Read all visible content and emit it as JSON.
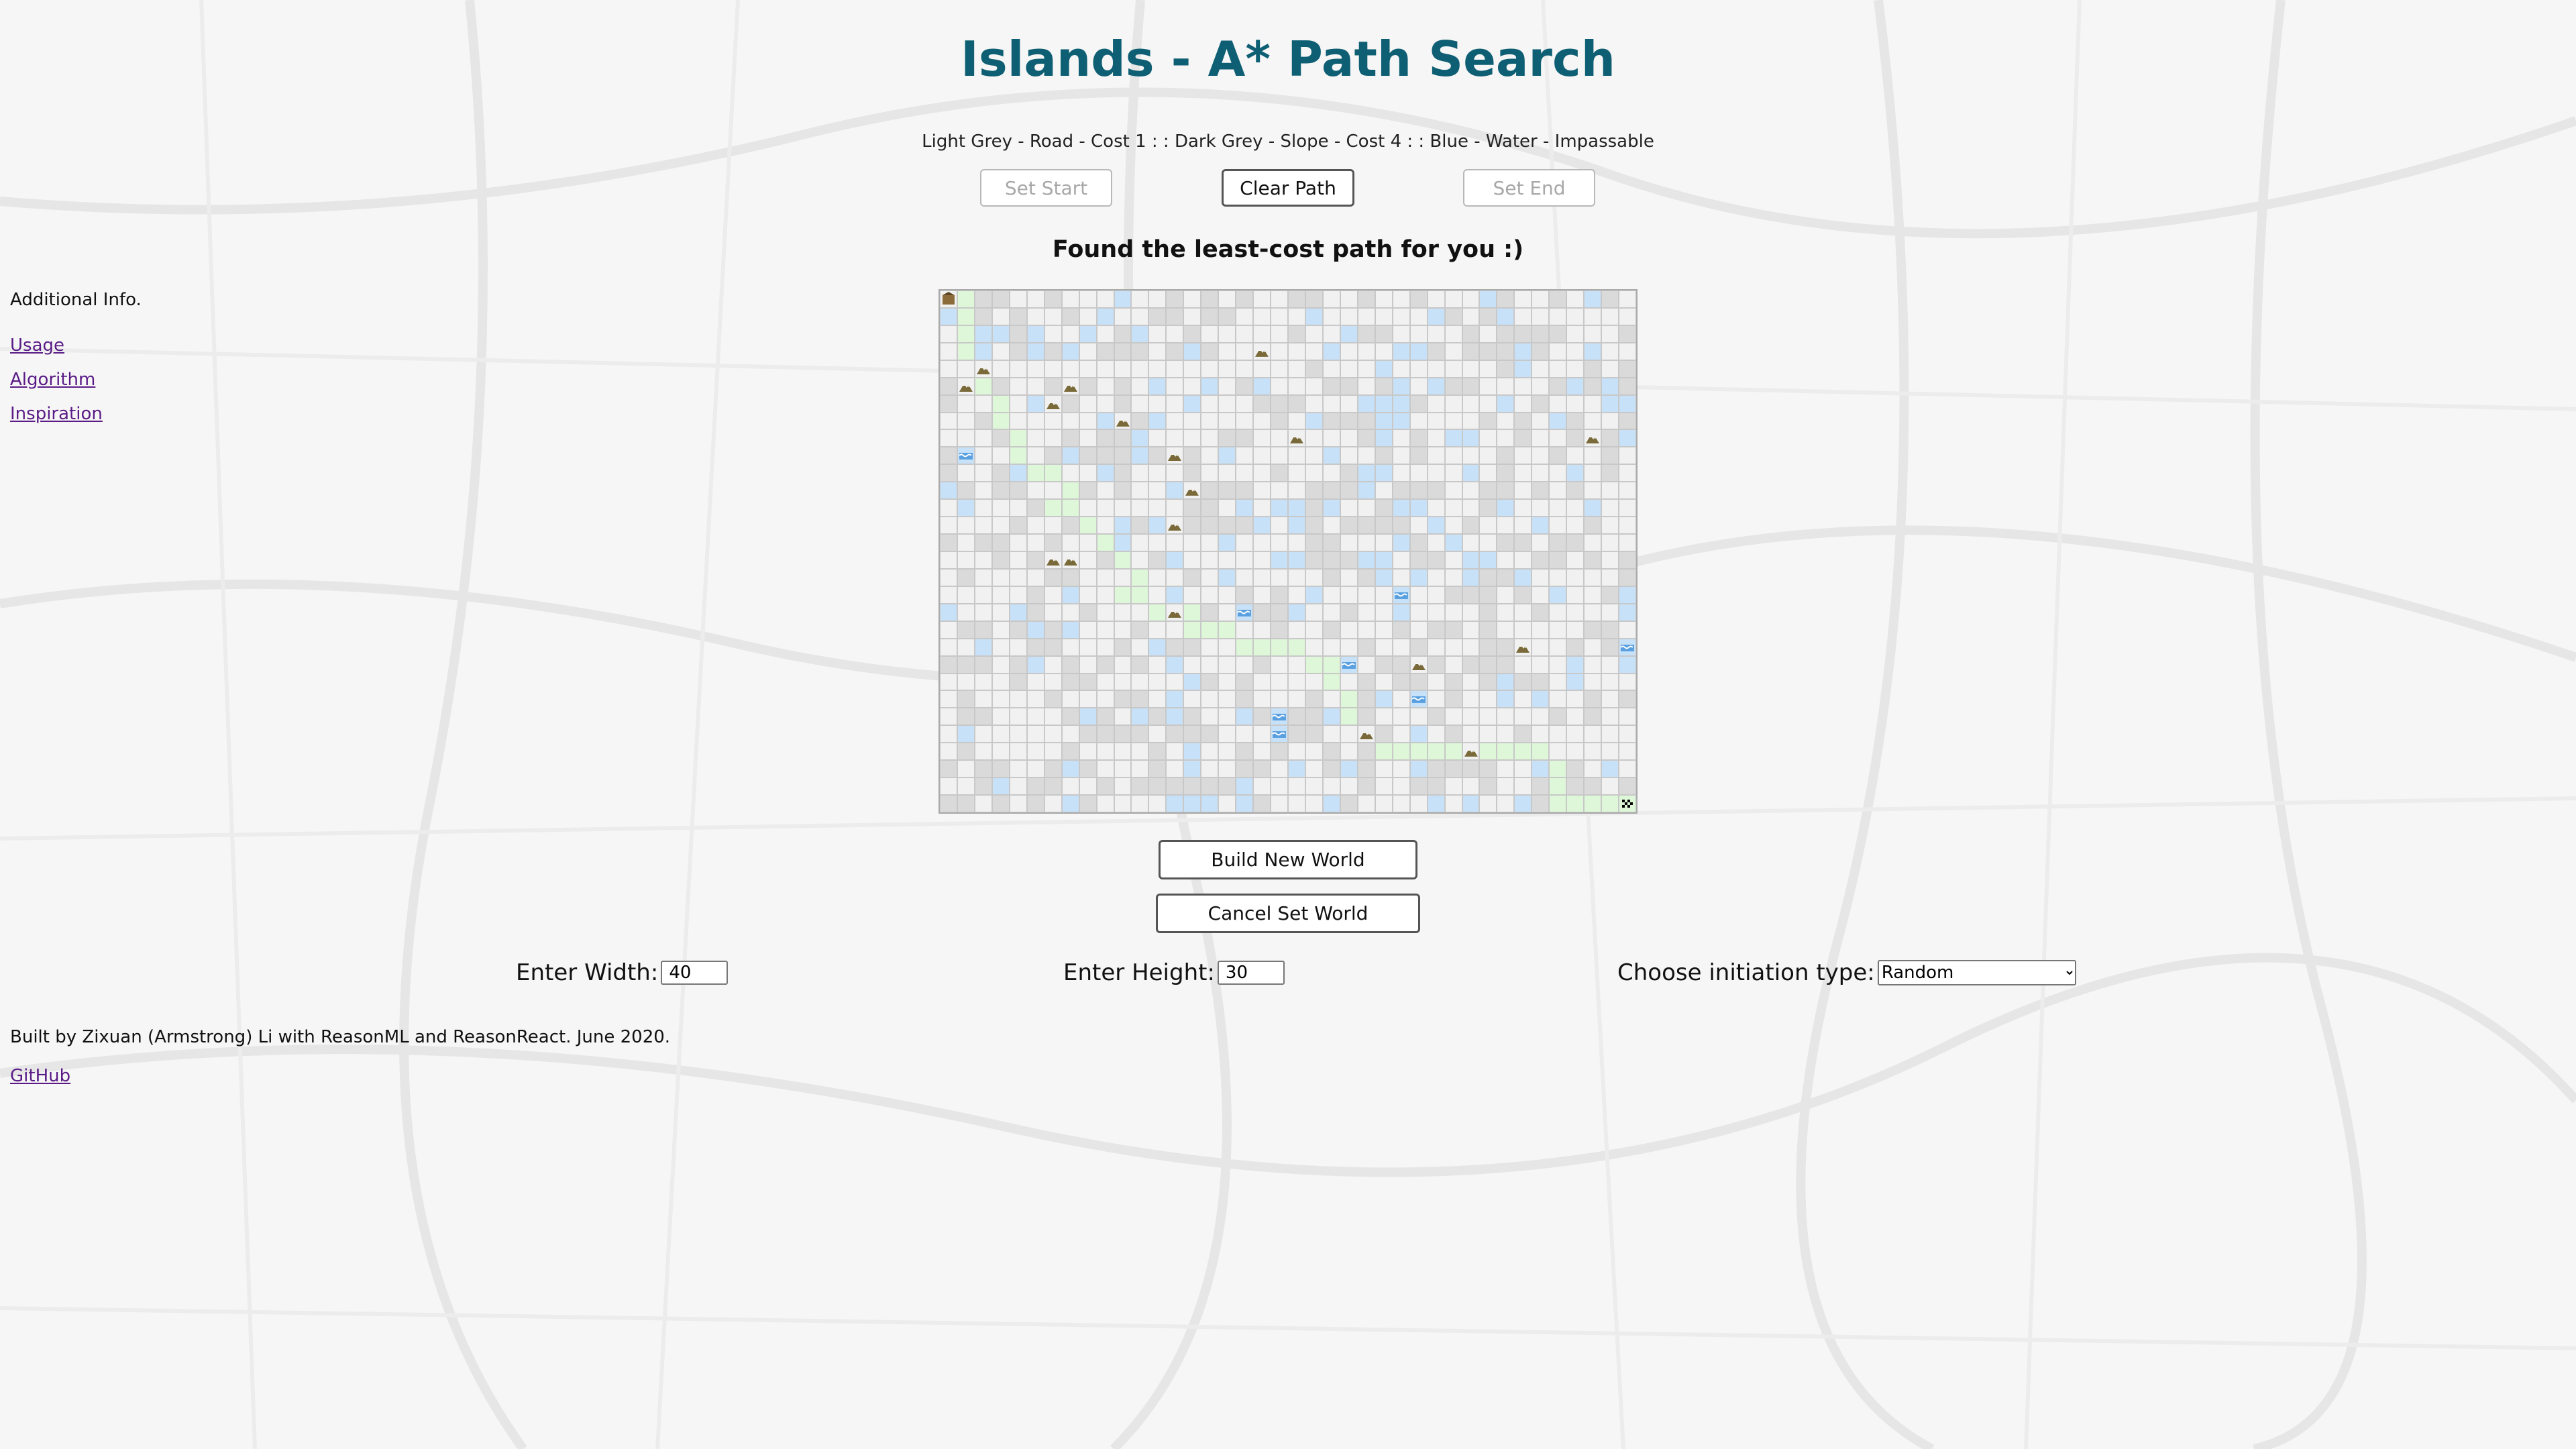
{
  "page": {
    "title": "Islands - A* Path Search",
    "legend": "Light Grey - Road - Cost 1 : : Dark Grey - Slope - Cost 4 : : Blue - Water - Impassable",
    "status": "Found the least-cost path for you :)"
  },
  "toolbar": {
    "set_start_label": "Set Start",
    "clear_path_label": "Clear Path",
    "set_end_label": "Set End"
  },
  "sidebar": {
    "header": "Additional Info.",
    "links": [
      {
        "label": "Usage"
      },
      {
        "label": "Algorithm"
      },
      {
        "label": "Inspiration"
      }
    ]
  },
  "world_actions": {
    "build_label": "Build New World",
    "cancel_label": "Cancel Set World"
  },
  "settings": {
    "width_label": "Enter Width:",
    "width_value": "40",
    "height_label": "Enter Height:",
    "height_value": "30",
    "init_label": "Choose initiation type:",
    "init_value": "Random"
  },
  "footer": {
    "credit": "Built by Zixuan (Armstrong) Li with ReasonML and ReasonReact. June 2020.",
    "github_label": "GitHub"
  },
  "grid": {
    "cols": 40,
    "rows": 30,
    "legend_colors": {
      "road": "#f1f1f1",
      "slope": "#dadada",
      "water": "#c7e1f8",
      "path": "#ddf7d8"
    },
    "start": [
      0,
      0
    ],
    "end": [
      29,
      39
    ],
    "mountain_icons": [
      [
        3,
        18
      ],
      [
        4,
        2
      ],
      [
        5,
        7
      ],
      [
        5,
        1
      ],
      [
        6,
        6
      ],
      [
        7,
        10
      ],
      [
        8,
        20
      ],
      [
        8,
        37
      ],
      [
        9,
        13
      ],
      [
        11,
        14
      ],
      [
        13,
        13
      ],
      [
        15,
        6
      ],
      [
        15,
        7
      ],
      [
        18,
        13
      ],
      [
        20,
        33
      ],
      [
        21,
        27
      ],
      [
        25,
        24
      ],
      [
        26,
        30
      ]
    ],
    "wave_icons": [
      [
        9,
        1
      ],
      [
        17,
        26
      ],
      [
        18,
        17
      ],
      [
        20,
        39
      ],
      [
        21,
        23
      ],
      [
        23,
        27
      ],
      [
        24,
        19
      ],
      [
        25,
        19
      ]
    ],
    "path_cells": [
      [
        0,
        1
      ],
      [
        1,
        1
      ],
      [
        2,
        1
      ],
      [
        3,
        1
      ],
      [
        4,
        2
      ],
      [
        5,
        2
      ],
      [
        6,
        3
      ],
      [
        7,
        3
      ],
      [
        8,
        4
      ],
      [
        9,
        4
      ],
      [
        10,
        5
      ],
      [
        10,
        6
      ],
      [
        11,
        7
      ],
      [
        12,
        7
      ],
      [
        13,
        8
      ],
      [
        14,
        9
      ],
      [
        15,
        10
      ],
      [
        16,
        11
      ],
      [
        17,
        11
      ],
      [
        18,
        12
      ],
      [
        18,
        13
      ],
      [
        18,
        14
      ],
      [
        19,
        15
      ],
      [
        19,
        16
      ],
      [
        20,
        17
      ],
      [
        20,
        18
      ],
      [
        21,
        22
      ],
      [
        22,
        22
      ],
      [
        23,
        23
      ],
      [
        24,
        23
      ],
      [
        25,
        24
      ],
      [
        26,
        25
      ],
      [
        26,
        26
      ],
      [
        26,
        27
      ],
      [
        26,
        28
      ],
      [
        26,
        29
      ],
      [
        26,
        30
      ],
      [
        26,
        31
      ],
      [
        26,
        32
      ],
      [
        26,
        33
      ],
      [
        26,
        34
      ],
      [
        27,
        35
      ],
      [
        28,
        35
      ],
      [
        29,
        35
      ],
      [
        29,
        36
      ],
      [
        29,
        37
      ],
      [
        29,
        38
      ],
      [
        21,
        21
      ],
      [
        20,
        19
      ],
      [
        20,
        20
      ],
      [
        19,
        14
      ],
      [
        17,
        10
      ],
      [
        12,
        6
      ]
    ]
  }
}
